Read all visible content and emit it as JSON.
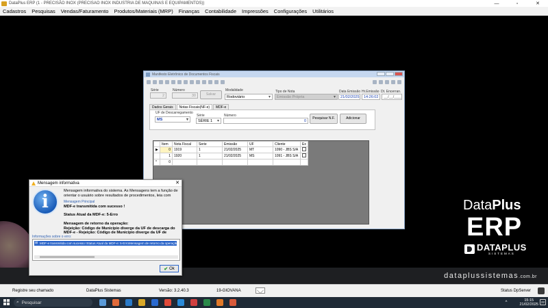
{
  "window": {
    "title": "DataPlus ERP (1 - PRECISÃO INOX (PRECISAO INOX INDUSTRIA DE MAQUINAS E EQUIPAMENTOS))",
    "minimize": "—",
    "maximize": "▫",
    "close": "✕"
  },
  "menu": [
    "Cadastros",
    "Pesquisas",
    "Vendas/Faturamento",
    "Produtos/Materiais (MRP)",
    "Finanças",
    "Contabilidade",
    "Impressões",
    "Configurações",
    "Utilitários"
  ],
  "brand": {
    "data": "Data",
    "plus": "Plus",
    "erp": "ERP",
    "company": "DATAPLUS",
    "company_sub": "SISTEMAS",
    "site": "dataplussistemas",
    "site_suffix": ".com.br"
  },
  "mdfe": {
    "title": "Manifesto Eletrônico de Documentos Fiscais",
    "serie_label": "Série",
    "serie_value": "2",
    "numero_label": "Número",
    "numero_value": "30",
    "salvar_label": "Salvar",
    "modalidade_label": "Modalidade",
    "modalidade_value": "Rodoviário",
    "tipo_nota_label": "Tipo de Nota",
    "tipo_nota_value": "Emissão Própria",
    "data_emissao_label": "Data Emissão",
    "data_emissao_value": "21/02/2025",
    "hr_emissao_label": "Hr.Emissão",
    "hr_emissao_value": "14:26:02",
    "dt_encerr_label": "Dt. Encerran.",
    "dt_encerr_value": "__/__/____",
    "tabs": [
      "Dados Gerais",
      "Notas Fiscais(NF-e)",
      "MDF-e"
    ],
    "uf_descarreg_label": "UF de Descarregamento",
    "uf_descarreg_value": "MS",
    "serie2_label": "Série",
    "serie2_value": "SÉRIE 1",
    "numero2_label": "Número",
    "numero2_value": "0",
    "pesquisar_label": "Pesquisar N.F.",
    "adicionar_label": "Adicionar",
    "grid": {
      "columns": [
        "Item",
        "Nota Fiscal",
        "Serie",
        "Emissão",
        "UF",
        "Cliente",
        "Ex"
      ],
      "rows": [
        {
          "marker": "▶",
          "item": "0",
          "nota": "1919",
          "serie": "1",
          "emissao": "21/02/2025",
          "uf": "MT",
          "cliente": "1090 - JBS S/A"
        },
        {
          "marker": "",
          "item": "1",
          "nota": "1920",
          "serie": "1",
          "emissao": "21/02/2025",
          "uf": "MS",
          "cliente": "1091 - JBS S/A"
        },
        {
          "marker": "*",
          "item": "0",
          "nota": "",
          "serie": "",
          "emissao": "",
          "uf": "",
          "cliente": ""
        }
      ]
    }
  },
  "dialog": {
    "title": "Mensagem informativa",
    "close": "✕",
    "intro": "Mensagem informativa do sistema. As Mensagens tem a função de orientar o usuário sobre resultados de procedimentos, leia com",
    "header": "Mensagem Principal",
    "main": "MDF-e transmitida com sucesso !",
    "status": "Status Atual da MDF-e: 5-Erro",
    "retorno_title": "Mensagem de retorno da operação:",
    "retorno_1": "Rejeição: Código de Município diverge da UF de descarga do",
    "retorno_2": "MDF-e - Rejeição: Código de Município diverge da UF de",
    "info_label": "Informações sobre o erro:",
    "detail": "MDF-e transmitida com sucesso !Status Atual da MDF-e: 5-ErroMensagem de retorno da operação:Rejeição",
    "ok": "Ok"
  },
  "statusbar": {
    "registrar": "Registre seu chamado",
    "company": "DataPlus Sistemas",
    "version": "Versão: 3.2.40.3",
    "user": "19-GIOVANA",
    "server": "Status DpServer"
  },
  "taskbar": {
    "search": "Pesquisar",
    "time": "15:15",
    "date": "21/02/2025",
    "notifications": "22"
  }
}
